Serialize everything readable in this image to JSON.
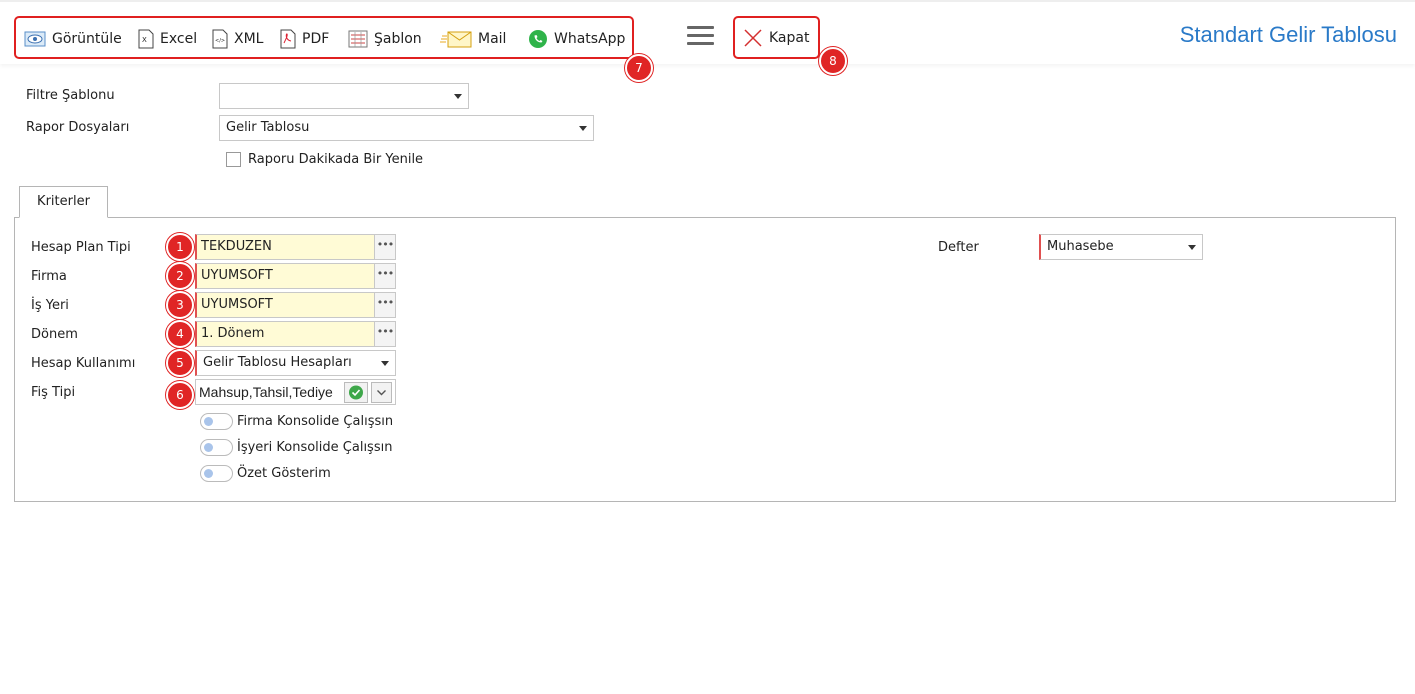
{
  "toolbar": {
    "view": "Görüntüle",
    "excel": "Excel",
    "xml": "XML",
    "pdf": "PDF",
    "template": "Şablon",
    "mail": "Mail",
    "whatsapp": "WhatsApp",
    "close": "Kapat"
  },
  "page_title": "Standart Gelir Tablosu",
  "badges": [
    "1",
    "2",
    "3",
    "4",
    "5",
    "6",
    "7",
    "8"
  ],
  "filter": {
    "template_label": "Filtre Şablonu",
    "template_value": "",
    "report_files_label": "Rapor Dosyaları",
    "report_files_value": "Gelir Tablosu",
    "refresh_label": "Raporu Dakikada Bir Yenile"
  },
  "tab": {
    "criteria": "Kriterler"
  },
  "criteria": {
    "plan_type_label": "Hesap Plan Tipi",
    "plan_type_value": "TEKDUZEN",
    "company_label": "Firma",
    "company_value": "UYUMSOFT",
    "workplace_label": "İş Yeri",
    "workplace_value": "UYUMSOFT",
    "period_label": "Dönem",
    "period_value": "1. Dönem",
    "account_usage_label": "Hesap Kullanımı",
    "account_usage_value": "Gelir Tablosu Hesapları",
    "voucher_type_label": "Fiş Tipi",
    "voucher_type_value": "Mahsup,Tahsil,Tediye",
    "ledger_label": "Defter",
    "ledger_value": "Muhasebe",
    "toggle_company": "Firma Konsolide Çalışsın",
    "toggle_workplace": "İşyeri Konsolide Çalışsın",
    "toggle_summary": "Özet Gösterim"
  },
  "colors": {
    "accent": "#2a7ac8",
    "highlight": "#e02020",
    "field_bg": "#fffbd6"
  }
}
